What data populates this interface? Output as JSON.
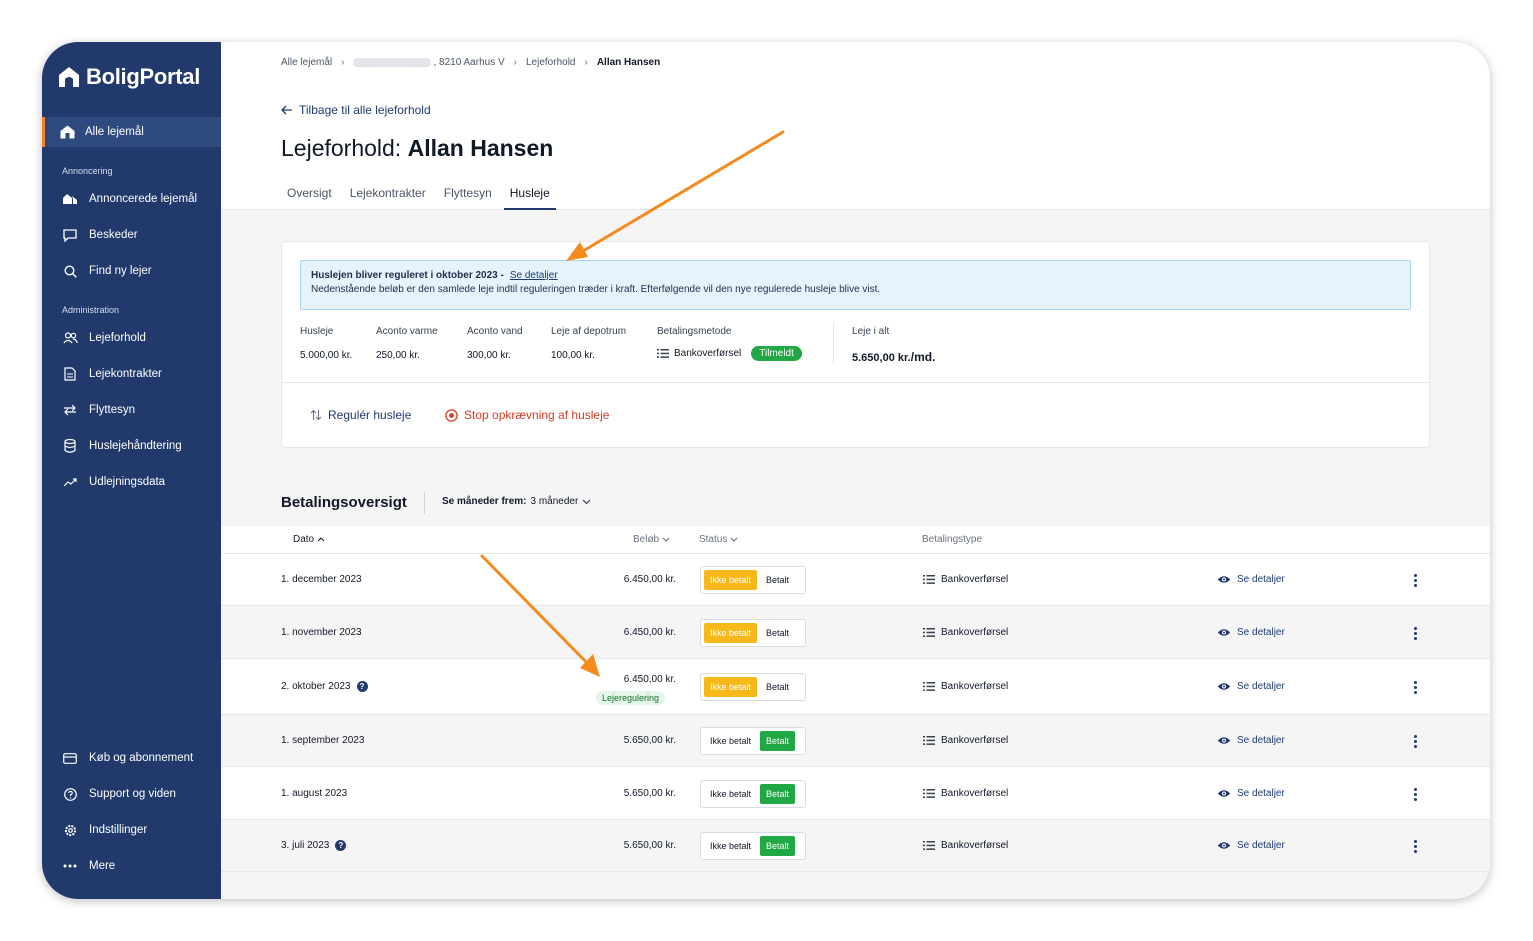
{
  "brand": {
    "name": "BoligPortal"
  },
  "sidebar": {
    "top_item": "Alle lejemål",
    "section_annoncering": "Annoncering",
    "annoncering_items": [
      "Annoncerede lejemål",
      "Beskeder",
      "Find ny lejer"
    ],
    "section_administration": "Administration",
    "administration_items": [
      "Lejeforhold",
      "Lejekontrakter",
      "Flyttesyn",
      "Huslejehåndtering",
      "Udlejningsdata"
    ],
    "bottom_items": [
      "Køb og abonnement",
      "Support og viden",
      "Indstillinger",
      "Mere"
    ]
  },
  "breadcrumb": {
    "items": [
      "Alle lejemål",
      ", 8210 Aarhus V",
      "Lejeforhold",
      "Allan Hansen"
    ]
  },
  "back_link": "Tilbage til alle lejeforhold",
  "page_title": {
    "prefix": "Lejeforhold:",
    "name": "Allan Hansen"
  },
  "tabs": [
    "Oversigt",
    "Lejekontrakter",
    "Flyttesyn",
    "Husleje"
  ],
  "active_tab": "Husleje",
  "notice": {
    "title": "Huslejen bliver reguleret i oktober 2023 -",
    "link": "Se detaljer",
    "body": "Nedenstående beløb er den samlede leje indtil reguleringen træder i kraft. Efterfølgende vil den nye regulerede husleje blive vist."
  },
  "rent_breakdown": {
    "husleje": {
      "label": "Husleje",
      "value": "5.000,00 kr."
    },
    "varme": {
      "label": "Aconto varme",
      "value": "250,00 kr."
    },
    "vand": {
      "label": "Aconto vand",
      "value": "300,00 kr."
    },
    "depotrum": {
      "label": "Leje af depotrum",
      "value": "100,00 kr."
    },
    "metode": {
      "label": "Betalingsmetode",
      "value": "Bankoverførsel",
      "badge": "Tilmeldt"
    },
    "total": {
      "label": "Leje i alt",
      "value": "5.650,00 kr.",
      "unit": "/md."
    }
  },
  "actions": {
    "adjust": "Regulér husleje",
    "stop": "Stop opkrævning af husleje"
  },
  "payments": {
    "title": "Betalingsoversigt",
    "filter_label": "Se måneder frem:",
    "filter_value": "3 måneder",
    "columns": {
      "date": "Dato",
      "amount": "Beløb",
      "status": "Status",
      "type": "Betalingstype"
    },
    "status_labels": {
      "unpaid": "Ikke betalt",
      "paid": "Betalt"
    },
    "details_label": "Se detaljer",
    "rows": [
      {
        "date": "1. december 2023",
        "amount": "6.450,00 kr.",
        "status": "unpaid",
        "type": "Bankoverførsel",
        "help": false,
        "badge": ""
      },
      {
        "date": "1. november 2023",
        "amount": "6.450,00 kr.",
        "status": "unpaid",
        "type": "Bankoverførsel",
        "help": false,
        "badge": ""
      },
      {
        "date": "2. oktober 2023",
        "amount": "6.450,00 kr.",
        "status": "unpaid",
        "type": "Bankoverførsel",
        "help": true,
        "badge": "Lejeregulering"
      },
      {
        "date": "1. september 2023",
        "amount": "5.650,00 kr.",
        "status": "paid",
        "type": "Bankoverførsel",
        "help": false,
        "badge": ""
      },
      {
        "date": "1. august 2023",
        "amount": "5.650,00 kr.",
        "status": "paid",
        "type": "Bankoverførsel",
        "help": false,
        "badge": ""
      },
      {
        "date": "3. juli 2023",
        "amount": "5.650,00 kr.",
        "status": "paid",
        "type": "Bankoverførsel",
        "help": true,
        "badge": ""
      }
    ]
  },
  "colors": {
    "sidebar": "#213a6b",
    "accent": "#f0832b",
    "paid": "#1fa844",
    "unpaid": "#f7b81a",
    "danger": "#d63b25"
  }
}
